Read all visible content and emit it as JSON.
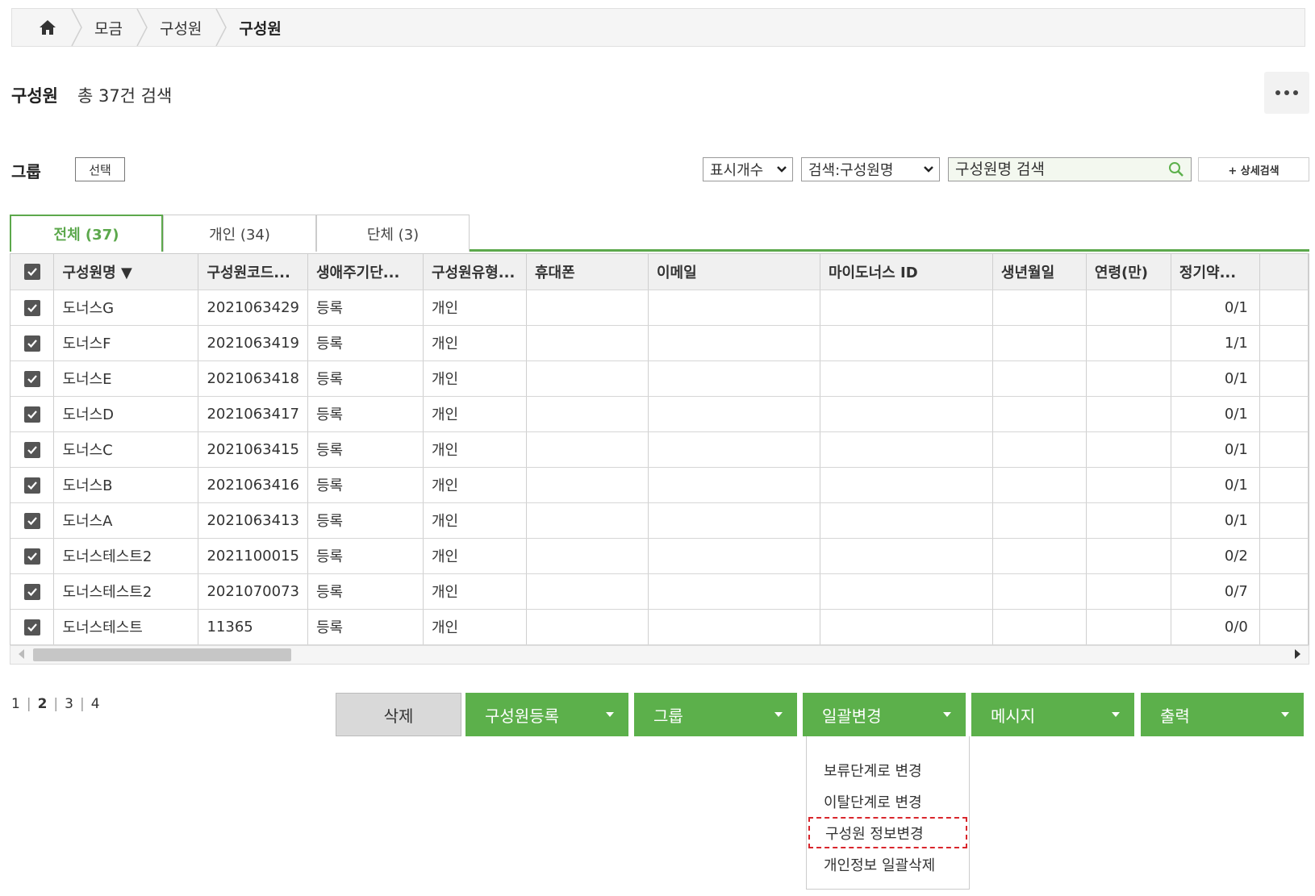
{
  "breadcrumb": {
    "items": [
      "모금",
      "구성원",
      "구성원"
    ]
  },
  "header": {
    "title": "구성원",
    "count_text": "총 37건 검색"
  },
  "filter": {
    "group_label": "그룹",
    "select_label": "선택",
    "display_count": "표시개수",
    "search_type": "검색:구성원명",
    "search_placeholder": "구성원명 검색",
    "advanced_search": "+ 상세검색"
  },
  "tabs": [
    {
      "label": "전체 (37)"
    },
    {
      "label": "개인 (34)"
    },
    {
      "label": "단체 (3)"
    }
  ],
  "table": {
    "headers": [
      "구성원명 ▼",
      "구성원코드...",
      "생애주기단...",
      "구성원유형...",
      "휴대폰",
      "이메일",
      "마이도너스 ID",
      "생년월일",
      "연령(만)",
      "정기약..."
    ],
    "rows": [
      {
        "name": "도너스G",
        "code": "2021063429",
        "lifecycle": "등록",
        "type": "개인",
        "phone": "",
        "email": "",
        "mydonus": "",
        "birth": "",
        "age": "",
        "regular": "0/1"
      },
      {
        "name": "도너스F",
        "code": "2021063419",
        "lifecycle": "등록",
        "type": "개인",
        "phone": "",
        "email": "",
        "mydonus": "",
        "birth": "",
        "age": "",
        "regular": "1/1"
      },
      {
        "name": "도너스E",
        "code": "2021063418",
        "lifecycle": "등록",
        "type": "개인",
        "phone": "",
        "email": "",
        "mydonus": "",
        "birth": "",
        "age": "",
        "regular": "0/1"
      },
      {
        "name": "도너스D",
        "code": "2021063417",
        "lifecycle": "등록",
        "type": "개인",
        "phone": "",
        "email": "",
        "mydonus": "",
        "birth": "",
        "age": "",
        "regular": "0/1"
      },
      {
        "name": "도너스C",
        "code": "2021063415",
        "lifecycle": "등록",
        "type": "개인",
        "phone": "",
        "email": "",
        "mydonus": "",
        "birth": "",
        "age": "",
        "regular": "0/1"
      },
      {
        "name": "도너스B",
        "code": "2021063416",
        "lifecycle": "등록",
        "type": "개인",
        "phone": "",
        "email": "",
        "mydonus": "",
        "birth": "",
        "age": "",
        "regular": "0/1"
      },
      {
        "name": "도너스A",
        "code": "2021063413",
        "lifecycle": "등록",
        "type": "개인",
        "phone": "",
        "email": "",
        "mydonus": "",
        "birth": "",
        "age": "",
        "regular": "0/1"
      },
      {
        "name": "도너스테스트2",
        "code": "2021100015",
        "lifecycle": "등록",
        "type": "개인",
        "phone": "",
        "email": "",
        "mydonus": "",
        "birth": "",
        "age": "",
        "regular": "0/2"
      },
      {
        "name": "도너스테스트2",
        "code": "2021070073",
        "lifecycle": "등록",
        "type": "개인",
        "phone": "",
        "email": "",
        "mydonus": "",
        "birth": "",
        "age": "",
        "regular": "0/7"
      },
      {
        "name": "도너스테스트",
        "code": "11365",
        "lifecycle": "등록",
        "type": "개인",
        "phone": "",
        "email": "",
        "mydonus": "",
        "birth": "",
        "age": "",
        "regular": "0/0"
      }
    ]
  },
  "pagination": {
    "pages": [
      "1",
      "2",
      "3",
      "4"
    ],
    "current": "2"
  },
  "actions": {
    "delete": "삭제",
    "register": "구성원등록",
    "group": "그룹",
    "bulk_change": "일괄변경",
    "message": "메시지",
    "print": "출력"
  },
  "bulk_menu": {
    "items": [
      "보류단계로 변경",
      "이탈단계로 변경",
      "구성원 정보변경",
      "개인정보 일괄삭제"
    ],
    "highlighted": "구성원 정보변경"
  },
  "colors": {
    "accent": "#5cb04b",
    "highlight_border": "#d9262c"
  }
}
